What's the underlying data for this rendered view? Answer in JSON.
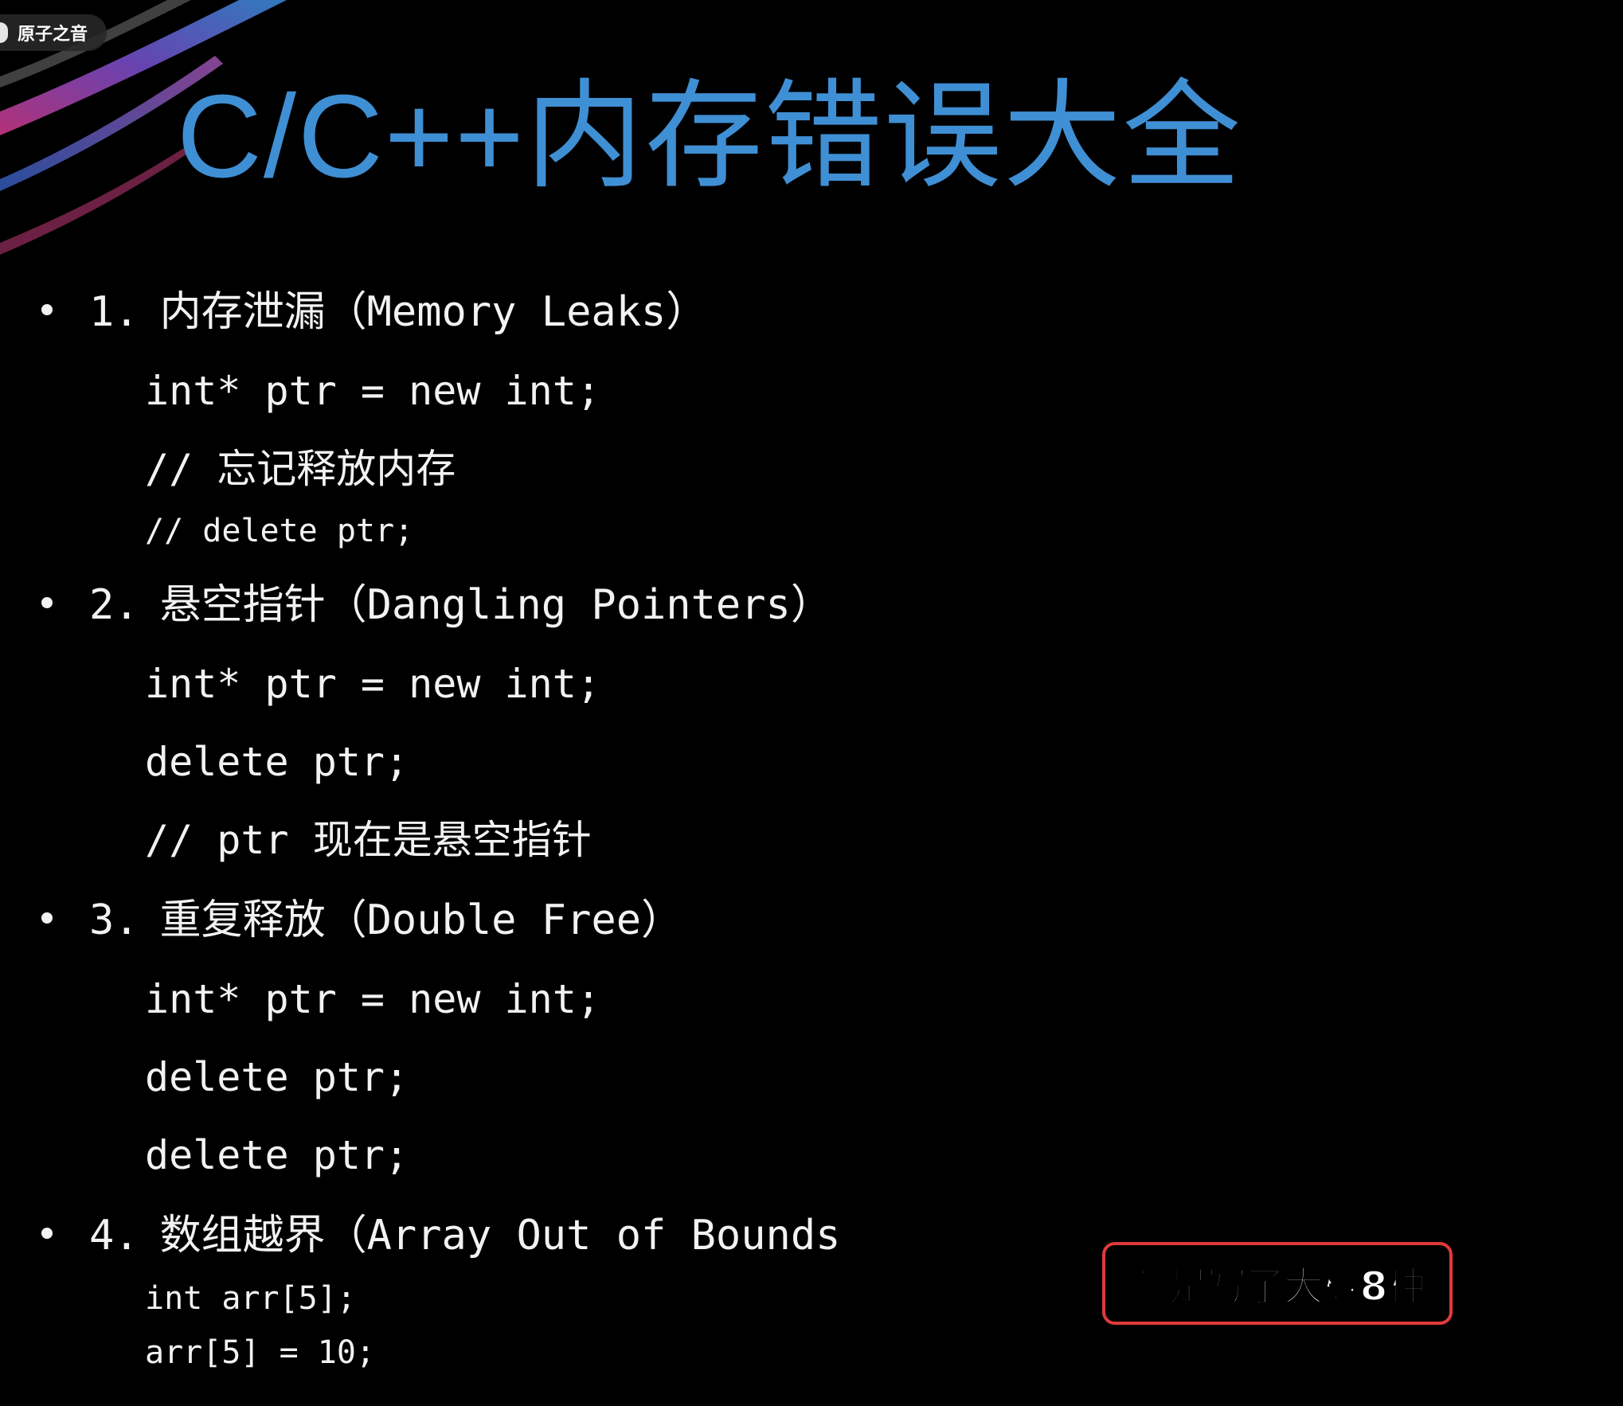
{
  "channel": {
    "name": "原子之音"
  },
  "slide": {
    "title": "C/C++内存错误大全",
    "sections": [
      {
        "number": "1.",
        "heading": "内存泄漏（Memory Leaks）",
        "lines": [
          "int* ptr = new int;",
          "// 忘记释放内存",
          "// delete ptr;"
        ]
      },
      {
        "number": "2.",
        "heading": "悬空指针（Dangling Pointers）",
        "lines": [
          "int* ptr = new int;",
          "delete ptr;",
          "// ptr 现在是悬空指针"
        ]
      },
      {
        "number": "3.",
        "heading": "重复释放（Double Free）",
        "lines": [
          "int* ptr = new int;",
          "delete ptr;",
          "delete ptr;"
        ]
      },
      {
        "number": "4.",
        "heading": "数组越界（Array Out of Bounds",
        "lines": [
          "int arr[5];",
          "arr[5] = 10;"
        ]
      }
    ]
  },
  "caption": {
    "text": "就是写了大概8种"
  },
  "colors": {
    "background": "#000000",
    "title": "#3f8fd4",
    "text": "#f2f2f2",
    "caption_border": "#e03a3a"
  }
}
